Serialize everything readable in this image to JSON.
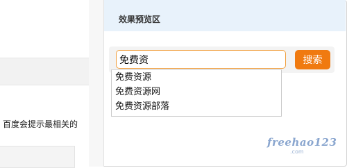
{
  "left": {
    "text": "百度会提示最相关的"
  },
  "preview": {
    "title": "效果预览区",
    "search": {
      "value": "免费资",
      "button_label": "搜索"
    },
    "suggestions": [
      "免费资源",
      "免费资源网",
      "免费资源部落"
    ]
  },
  "watermark": {
    "brand": "freehao123",
    "domain": ".com"
  },
  "colors": {
    "accent_orange": "#f07a10",
    "header_blue": "#e8f2fb",
    "input_border": "#f0a040"
  }
}
